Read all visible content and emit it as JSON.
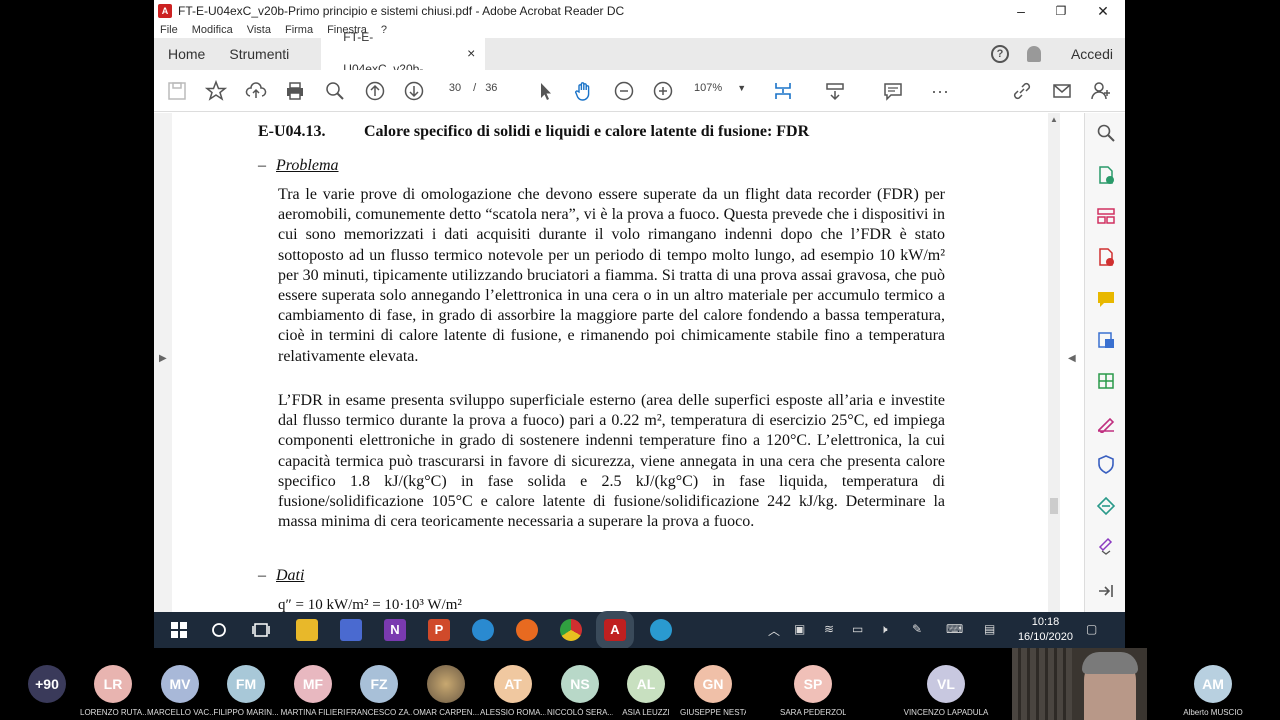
{
  "window": {
    "title": "FT-E-U04exC_v20b-Primo principio e sistemi chiusi.pdf - Adobe Acrobat Reader DC",
    "minimize": "–",
    "maximize": "❐",
    "close": "✕"
  },
  "menu": [
    "File",
    "Modifica",
    "Vista",
    "Firma",
    "Finestra",
    "?"
  ],
  "tabs": {
    "home": "Home",
    "tools": "Strumenti",
    "document": "FT-E-U04exC_v20b-...",
    "close": "×",
    "signin": "Accedi"
  },
  "toolbar": {
    "page_current": "30",
    "page_separator": "/",
    "page_total": "36",
    "zoom": "107%"
  },
  "document": {
    "heading_number": "E-U04.13.",
    "heading_title": "Calore specifico di solidi e liquidi e calore latente di fusione: FDR",
    "section1_dash": "–",
    "section1_label": "Problema",
    "para1": "Tra le varie prove di omologazione che devono essere superate da un flight data recorder (FDR) per aeromobili, comunemente detto “scatola nera”, vi è la prova a fuoco. Questa prevede che i dispositivi in cui sono memorizzati i dati acquisiti durante il volo rimangano indenni dopo che l’FDR è stato sottoposto ad un flusso termico notevole per un periodo di tempo molto lungo, ad esempio 10 kW/m² per 30 minuti, tipicamente utilizzando bruciatori a fiamma. Si tratta di una prova assai gravosa, che può essere superata solo annegando l’elettronica in una cera o in un altro materiale per accumulo termico a cambiamento di fase, in grado di assorbire la maggiore parte del calore fondendo a bassa temperatura, cioè in termini di calore latente di fusione, e rimanendo poi chimicamente stabile fino a temperatura relativamente elevata.",
    "para2": "L’FDR in esame presenta sviluppo superficiale esterno (area delle superfici esposte all’aria e investite dal flusso termico durante la prova a fuoco) pari a 0.22 m², temperatura di esercizio 25°C, ed impiega componenti elettroniche in grado di sostenere indenni temperature fino a 120°C. L’elettronica, la cui capacità termica può trascurarsi in favore di sicurezza, viene annegata in una cera che presenta calore specifico 1.8 kJ/(kg°C) in fase solida e 2.5 kJ/(kg°C) in fase liquida, temperatura di fusione/solidificazione 105°C e calore latente di fusione/solidificazione 242 kJ/kg. Determinare la massa minima di cera teoricamente necessaria a superare la prova a fuoco.",
    "section2_dash": "–",
    "section2_label": "Dati",
    "formula": "q″ = 10 kW/m² = 10·10³ W/m²"
  },
  "taskbar": {
    "time": "10:18",
    "date": "16/10/2020"
  },
  "participants": [
    {
      "initials": "+90",
      "name": "",
      "color": "#3a3a5a"
    },
    {
      "initials": "LR",
      "name": "LORENZO RUTA...",
      "color": "#e8b4b0"
    },
    {
      "initials": "MV",
      "name": "MARCELLO VAC...",
      "color": "#a8b8d8"
    },
    {
      "initials": "FM",
      "name": "FILIPPO MARIN...",
      "color": "#a8c8d8"
    },
    {
      "initials": "MF",
      "name": "MARTINA FILIERI",
      "color": "#e8b8c0"
    },
    {
      "initials": "FZ",
      "name": "FRANCESCO ZA...",
      "color": "#a8c0d8"
    },
    {
      "initials": "",
      "name": "OMAR CARPEN...",
      "color": "#6b5a45"
    },
    {
      "initials": "AT",
      "name": "ALESSIO ROMA...",
      "color": "#f0c8a0"
    },
    {
      "initials": "NS",
      "name": "NICCOLÒ SERA...",
      "color": "#b8d8c8"
    },
    {
      "initials": "AL",
      "name": "ASIA LEUZZI",
      "color": "#c8e0c0"
    },
    {
      "initials": "GN",
      "name": "GIUSEPPE NESTA",
      "color": "#f0c0a8"
    },
    {
      "initials": "SP",
      "name": "SARA PEDERZOLI",
      "color": "#f0c0b8"
    },
    {
      "initials": "VL",
      "name": "VINCENZO LAPADULA",
      "color": "#c8c8e0"
    },
    {
      "initials": "AM",
      "name": "Alberto MUSCIO",
      "color": "#b8d0e0"
    }
  ]
}
